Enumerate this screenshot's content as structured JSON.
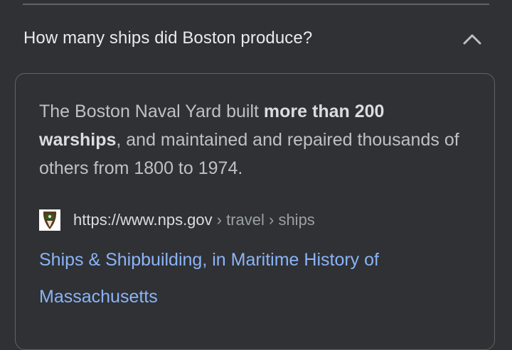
{
  "question": {
    "text": "How many ships did Boston produce?",
    "expanded_icon": "chevron-up-icon"
  },
  "answer": {
    "text_before": "The Boston Naval Yard built ",
    "text_bold": "more than 200 warships",
    "text_after": ", and maintained and repaired thousands of others from 1800 to 1974."
  },
  "source": {
    "favicon": "nps-arrowhead-favicon",
    "domain": "https://www.nps.gov",
    "path": "› travel › ships",
    "link_title": "Ships & Shipbuilding, in Maritime History of Massachusetts"
  },
  "colors": {
    "background": "#303134",
    "link": "#8ab4f8",
    "text": "#bdc1c6"
  }
}
